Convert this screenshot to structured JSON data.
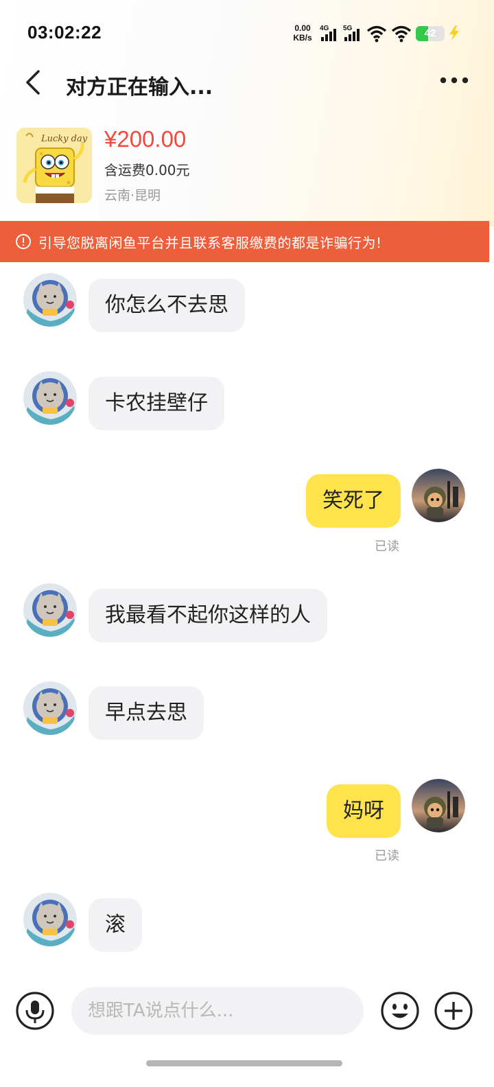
{
  "status_bar": {
    "time": "03:02:22",
    "net_speed_value": "0.00",
    "net_speed_unit": "KB/s",
    "sim1_label": "4G",
    "sim2_label": "5G",
    "battery": "42",
    "battery_color": "#36c84a"
  },
  "header": {
    "title": "对方正在输入..."
  },
  "product": {
    "image_text": "Lucky day",
    "price": "¥200.00",
    "shipping": "含运费0.00元",
    "location": "云南·昆明",
    "price_color": "#f04a3f"
  },
  "warning": {
    "text": "引导您脱离闲鱼平台并且联系客服缴费的都是诈骗行为!",
    "color": "#ed5f3b"
  },
  "messages": [
    {
      "side": "left",
      "text": "你怎么不去思"
    },
    {
      "side": "left",
      "text": "卡农挂壁仔"
    },
    {
      "side": "right",
      "text": "笑死了",
      "status": "已读"
    },
    {
      "side": "left",
      "text": "我最看不起你这样的人"
    },
    {
      "side": "left",
      "text": "早点去思"
    },
    {
      "side": "right",
      "text": "妈呀",
      "status": "已读"
    },
    {
      "side": "left",
      "text": "滚"
    }
  ],
  "input_bar": {
    "placeholder": "想跟TA说点什么...",
    "icons": [
      "mic-icon",
      "emoji-icon",
      "plus-icon"
    ]
  },
  "colors": {
    "my_bubble": "#ffe34d",
    "their_bubble": "#f2f2f4"
  }
}
